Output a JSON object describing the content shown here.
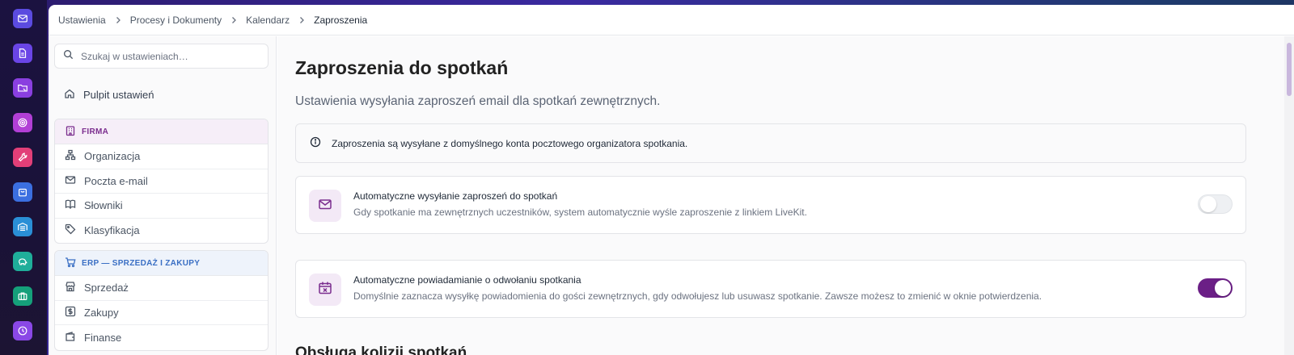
{
  "rail": {
    "icons": [
      {
        "name": "mail-icon",
        "color": "#5b4be0"
      },
      {
        "name": "document-icon",
        "color": "#6a45e6"
      },
      {
        "name": "folder-icon",
        "color": "#8a3fe0"
      },
      {
        "name": "target-icon",
        "color": "#b23fd6"
      },
      {
        "name": "wrench-icon",
        "color": "#e23f78"
      },
      {
        "name": "bag-icon",
        "color": "#3b6fe0"
      },
      {
        "name": "warehouse-icon",
        "color": "#2a8fd6"
      },
      {
        "name": "piggy-bank-icon",
        "color": "#1fae9a"
      },
      {
        "name": "briefcase-icon",
        "color": "#15a07a"
      },
      {
        "name": "clock-icon",
        "color": "#8a48e6"
      }
    ]
  },
  "breadcrumb": {
    "items": [
      "Ustawienia",
      "Procesy i Dokumenty",
      "Kalendarz"
    ],
    "current": "Zaproszenia"
  },
  "sidebar": {
    "search_placeholder": "Szukaj w ustawieniach…",
    "dashboard": "Pulpit ustawień",
    "groups": [
      {
        "title": "FIRMA",
        "items": [
          "Organizacja",
          "Poczta e-mail",
          "Słowniki",
          "Klasyfikacja"
        ]
      },
      {
        "title": "ERP — SPRZEDAŻ I ZAKUPY",
        "items": [
          "Sprzedaż",
          "Zakupy",
          "Finanse"
        ]
      }
    ]
  },
  "main": {
    "title": "Zaproszenia do spotkań",
    "subtitle": "Ustawienia wysyłania zaproszeń email dla spotkań zewnętrznych.",
    "info": "Zaproszenia są wysyłane z domyślnego konta pocztowego organizatora spotkania.",
    "cards": [
      {
        "title": "Automatyczne wysyłanie zaproszeń do spotkań",
        "description": "Gdy spotkanie ma zewnętrznych uczestników, system automatycznie wyśle zaproszenie z linkiem LiveKit.",
        "enabled": false
      },
      {
        "title": "Automatyczne powiadamianie o odwołaniu spotkania",
        "description": "Domyślnie zaznacza wysyłkę powiadomienia do gości zewnętrznych, gdy odwołujesz lub usuwasz spotkanie. Zawsze możesz to zmienić w oknie potwierdzenia.",
        "enabled": true
      }
    ],
    "next_section": "Obsługa kolizji spotkań"
  },
  "colors": {
    "accent": "#6b1f86",
    "firma": "#7b2d8e",
    "erp": "#3a6fc4"
  }
}
